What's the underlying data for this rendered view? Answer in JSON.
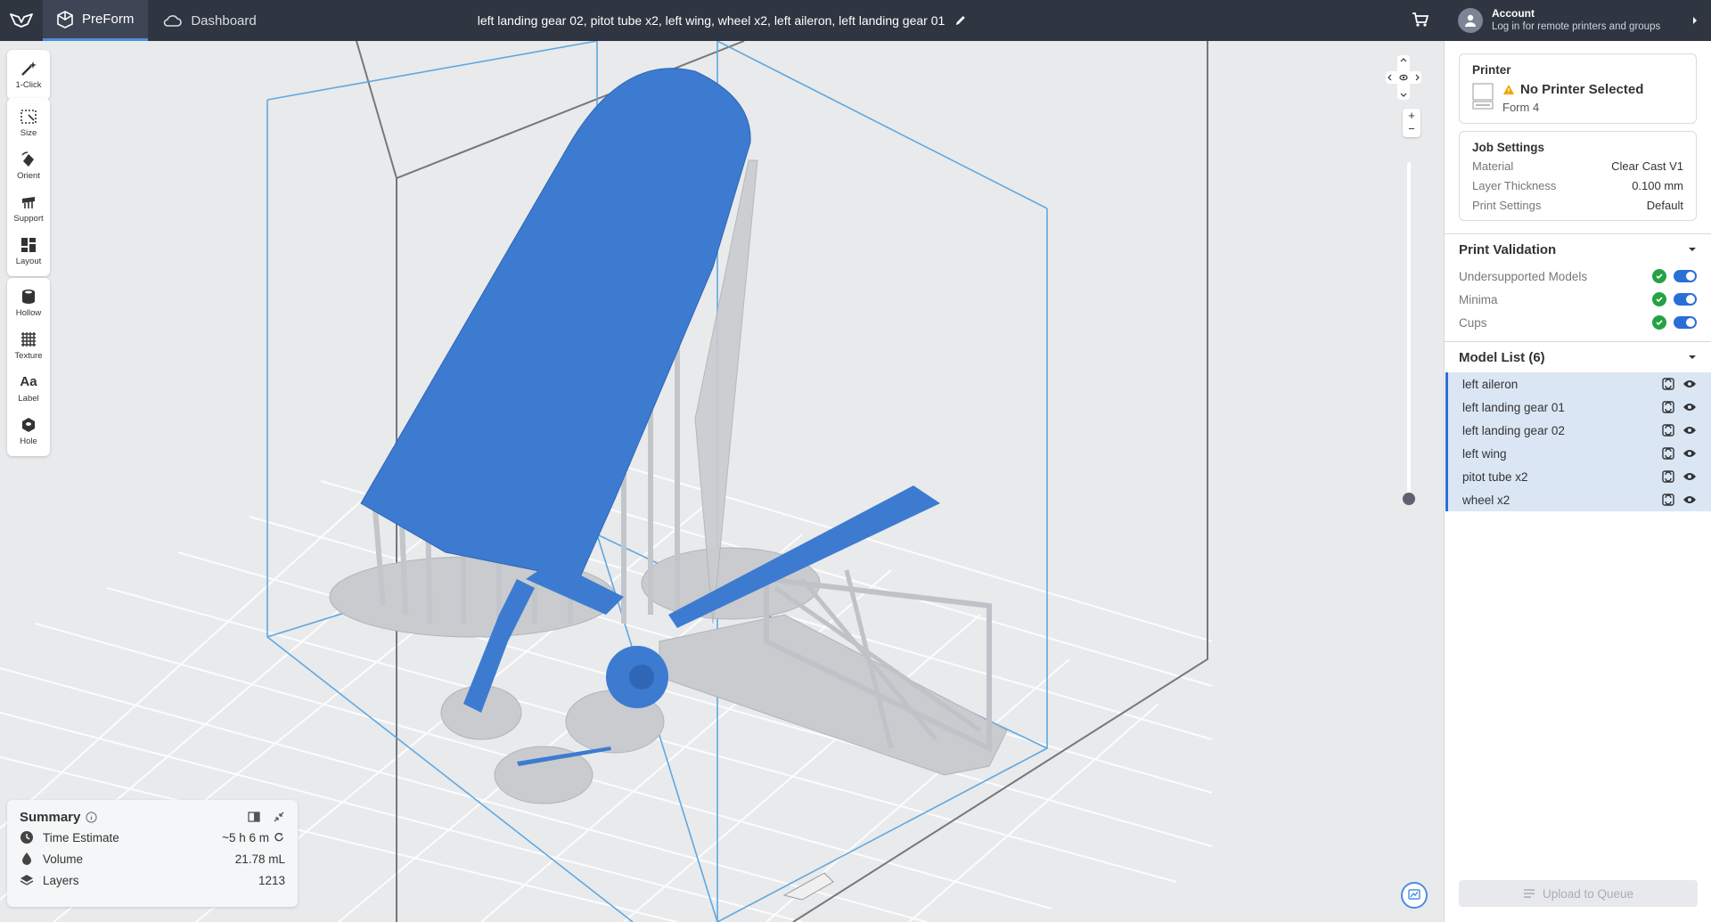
{
  "app": {
    "name": "PreForm",
    "dashboard_label": "Dashboard"
  },
  "document": {
    "title": "left landing gear 02, pitot tube x2, left wing, wheel x2, left aileron, left landing gear 01"
  },
  "account": {
    "title": "Account",
    "subtitle": "Log in for remote printers and groups"
  },
  "toolbar": {
    "group1": [
      {
        "label": "1-Click",
        "icon": "magic-wand-icon"
      }
    ],
    "group2": [
      {
        "label": "Size",
        "icon": "size-icon"
      },
      {
        "label": "Orient",
        "icon": "orient-icon"
      },
      {
        "label": "Support",
        "icon": "support-icon"
      },
      {
        "label": "Layout",
        "icon": "layout-icon"
      }
    ],
    "group3": [
      {
        "label": "Hollow",
        "icon": "hollow-icon"
      },
      {
        "label": "Texture",
        "icon": "texture-icon"
      },
      {
        "label": "Label",
        "icon": "label-icon",
        "glyph": "Aa"
      },
      {
        "label": "Hole",
        "icon": "hole-icon"
      }
    ]
  },
  "summary": {
    "title": "Summary",
    "rows": [
      {
        "label": "Time Estimate",
        "value": "~5 h 6 m"
      },
      {
        "label": "Volume",
        "value": "21.78 mL"
      },
      {
        "label": "Layers",
        "value": "1213"
      }
    ]
  },
  "printer": {
    "section_title": "Printer",
    "name": "No Printer Selected",
    "model": "Form 4",
    "warning_color": "#f0a500"
  },
  "job_settings": {
    "title": "Job Settings",
    "rows": [
      {
        "key": "Material",
        "value": "Clear Cast V1"
      },
      {
        "key": "Layer Thickness",
        "value": "0.100 mm"
      },
      {
        "key": "Print Settings",
        "value": "Default"
      }
    ]
  },
  "print_validation": {
    "title": "Print Validation",
    "rows": [
      {
        "label": "Undersupported Models",
        "enabled": true
      },
      {
        "label": "Minima",
        "enabled": true
      },
      {
        "label": "Cups",
        "enabled": true
      }
    ]
  },
  "model_list": {
    "title": "Model List (6)",
    "items": [
      "left aileron",
      "left landing gear 01",
      "left landing gear 02",
      "left wing",
      "pitot tube x2",
      "wheel x2"
    ]
  },
  "upload_button": {
    "label": "Upload to Queue"
  },
  "colors": {
    "accent": "#2a6fd6",
    "selected_model": "#3d7bd1",
    "support": "#c9cbcf",
    "topbar": "#2f3541"
  }
}
